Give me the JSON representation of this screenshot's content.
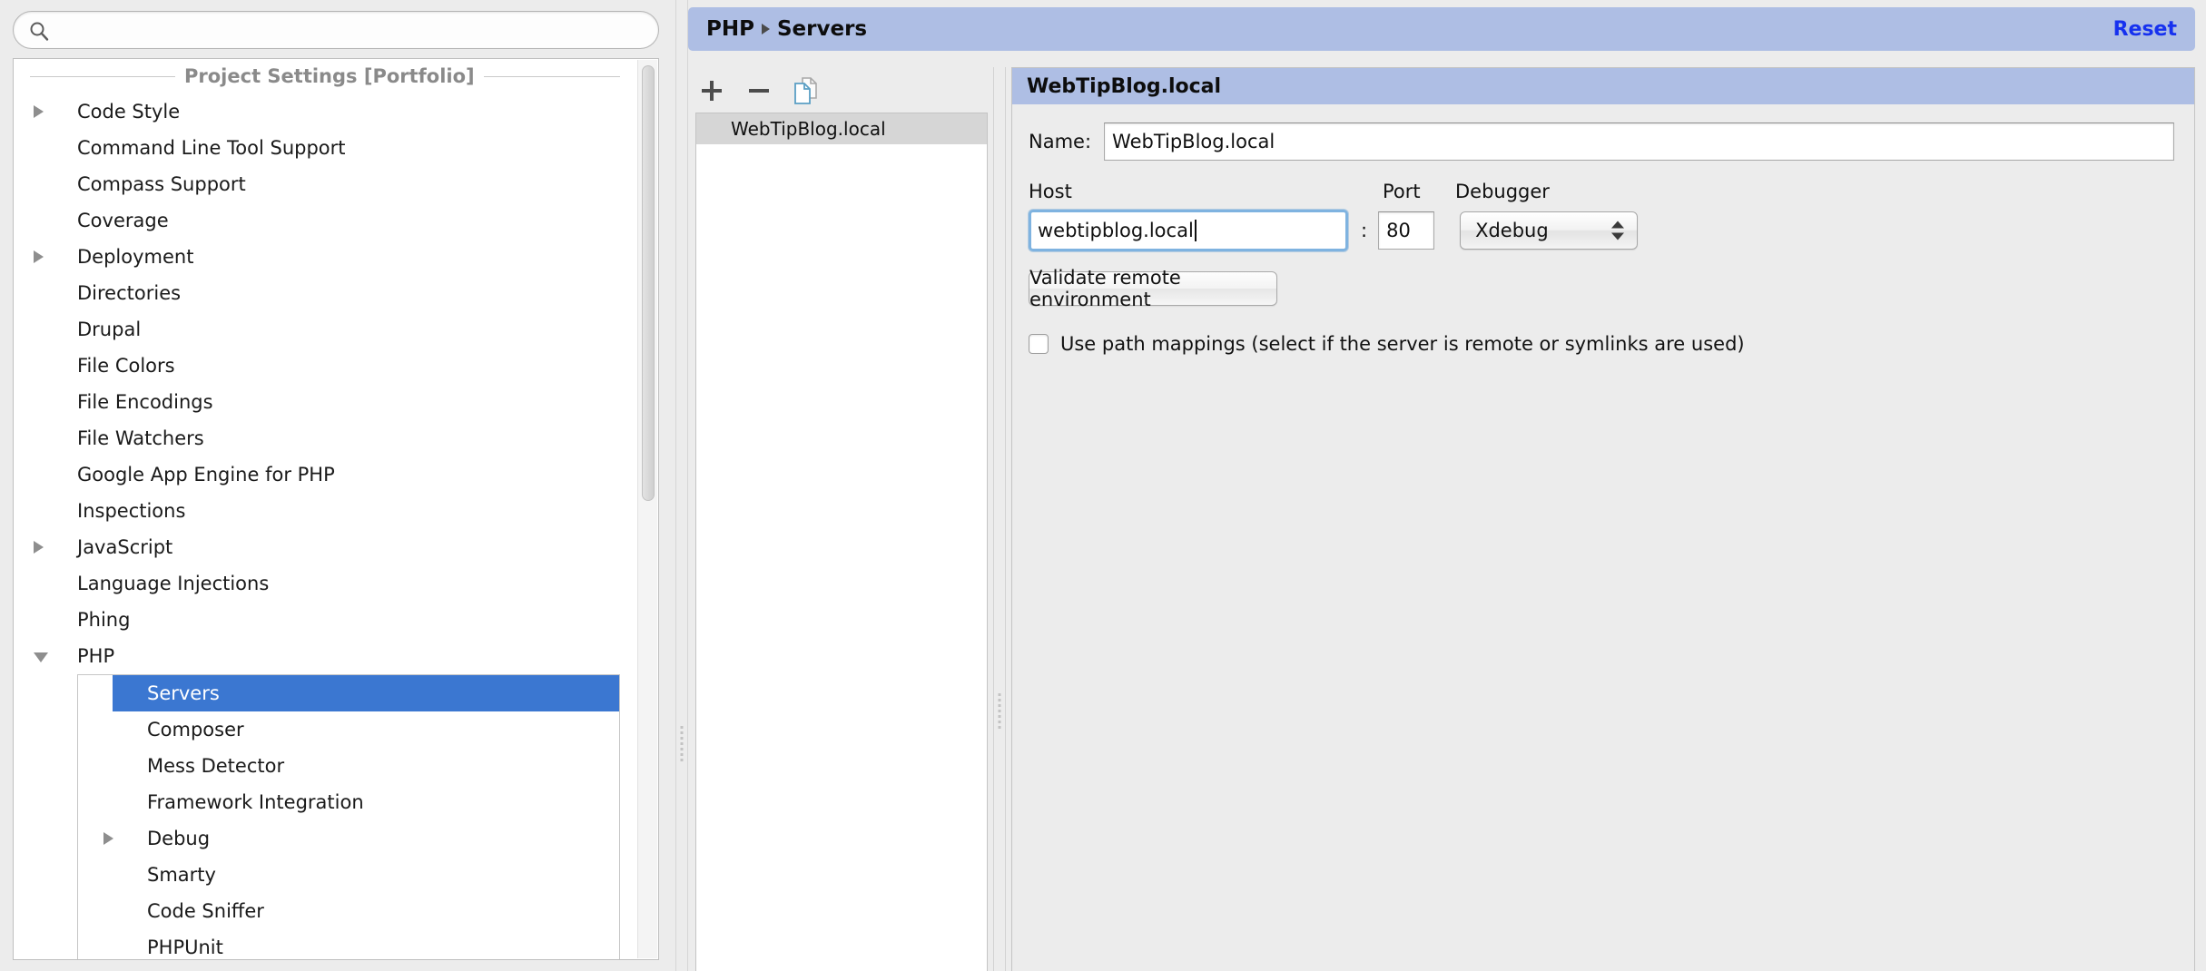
{
  "search": {
    "value": "",
    "placeholder": "",
    "icon": "search-icon"
  },
  "sidebar": {
    "section_title": "Project Settings [Portfolio]",
    "items": [
      {
        "label": "Code Style",
        "twisty": "collapsed"
      },
      {
        "label": "Command Line Tool Support",
        "twisty": "none"
      },
      {
        "label": "Compass Support",
        "twisty": "none"
      },
      {
        "label": "Coverage",
        "twisty": "none"
      },
      {
        "label": "Deployment",
        "twisty": "collapsed"
      },
      {
        "label": "Directories",
        "twisty": "none"
      },
      {
        "label": "Drupal",
        "twisty": "none"
      },
      {
        "label": "File Colors",
        "twisty": "none"
      },
      {
        "label": "File Encodings",
        "twisty": "none"
      },
      {
        "label": "File Watchers",
        "twisty": "none"
      },
      {
        "label": "Google App Engine for PHP",
        "twisty": "none"
      },
      {
        "label": "Inspections",
        "twisty": "none"
      },
      {
        "label": "JavaScript",
        "twisty": "collapsed"
      },
      {
        "label": "Language Injections",
        "twisty": "none"
      },
      {
        "label": "Phing",
        "twisty": "none"
      },
      {
        "label": "PHP",
        "twisty": "expanded"
      }
    ],
    "php_children": [
      {
        "label": "Servers",
        "twisty": "none",
        "selected": true
      },
      {
        "label": "Composer",
        "twisty": "none",
        "selected": false
      },
      {
        "label": "Mess Detector",
        "twisty": "none",
        "selected": false
      },
      {
        "label": "Framework Integration",
        "twisty": "none",
        "selected": false
      },
      {
        "label": "Debug",
        "twisty": "collapsed",
        "selected": false
      },
      {
        "label": "Smarty",
        "twisty": "none",
        "selected": false
      },
      {
        "label": "Code Sniffer",
        "twisty": "none",
        "selected": false
      },
      {
        "label": "PHPUnit",
        "twisty": "none",
        "selected": false
      }
    ]
  },
  "header": {
    "crumb_root": "PHP",
    "crumb_leaf": "Servers",
    "reset_label": "Reset",
    "reset_color": "#1631ef",
    "bar_color": "#aebee4"
  },
  "server_list": {
    "toolbar": {
      "add_label": "+",
      "remove_label": "−",
      "copy_label": "copy-icon"
    },
    "items": [
      {
        "label": "WebTipBlog.local",
        "selected": true
      }
    ]
  },
  "form": {
    "title": "WebTipBlog.local",
    "name_label": "Name:",
    "name_value": "WebTipBlog.local",
    "host_label": "Host",
    "host_value": "webtipblog.local",
    "port_label": "Port",
    "port_value": "80",
    "colon": ":",
    "debugger_label": "Debugger",
    "debugger_value": "Xdebug",
    "debugger_options": [
      "Xdebug"
    ],
    "validate_label": "Validate remote environment",
    "pathmap_label": "Use path mappings (select if the server is remote or symlinks are used)",
    "pathmap_checked": false,
    "focus_color": "#7fb3e0",
    "selection_color": "#3b77d1"
  }
}
